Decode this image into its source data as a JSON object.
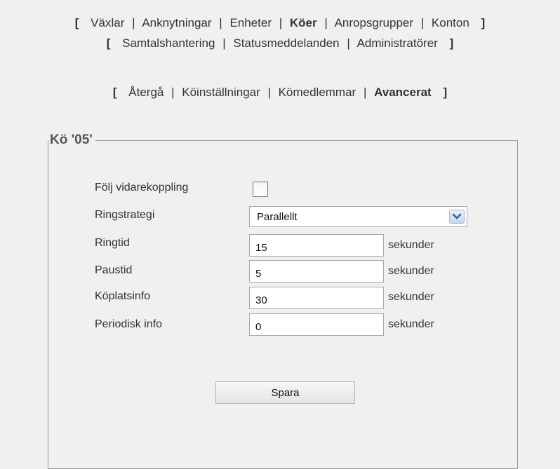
{
  "nav_main": {
    "items": [
      "Växlar",
      "Anknytningar",
      "Enheter",
      "Köer",
      "Anropsgrupper",
      "Konton"
    ],
    "active": "Köer"
  },
  "nav_sub": {
    "items": [
      "Samtalshantering",
      "Statusmeddelanden",
      "Administratörer"
    ]
  },
  "nav_queue": {
    "items": [
      "Återgå",
      "Köinställningar",
      "Kömedlemmar",
      "Avancerat"
    ],
    "active": "Avancerat"
  },
  "brackets": {
    "open": "[",
    "close": "]",
    "sep": "|"
  },
  "panel": {
    "legend": "Kö '05'"
  },
  "form": {
    "follow_forward": {
      "label": "Följ vidarekoppling",
      "checked": false
    },
    "ring_strategy": {
      "label": "Ringstrategi",
      "value": "Parallellt"
    },
    "ring_time": {
      "label": "Ringtid",
      "value": "15",
      "unit": "sekunder"
    },
    "pause_time": {
      "label": "Paustid",
      "value": "5",
      "unit": "sekunder"
    },
    "queue_position_info": {
      "label": "Köplatsinfo",
      "value": "30",
      "unit": "sekunder"
    },
    "periodic_info": {
      "label": "Periodisk info",
      "value": "0",
      "unit": "sekunder"
    },
    "save_label": "Spara"
  },
  "icons": {
    "dropdown": "chevron-down-icon"
  },
  "colors": {
    "background": "#f0f0f0",
    "text": "#333333",
    "border": "#9a9a9a",
    "dropdown_button": "#c7d6ef"
  }
}
